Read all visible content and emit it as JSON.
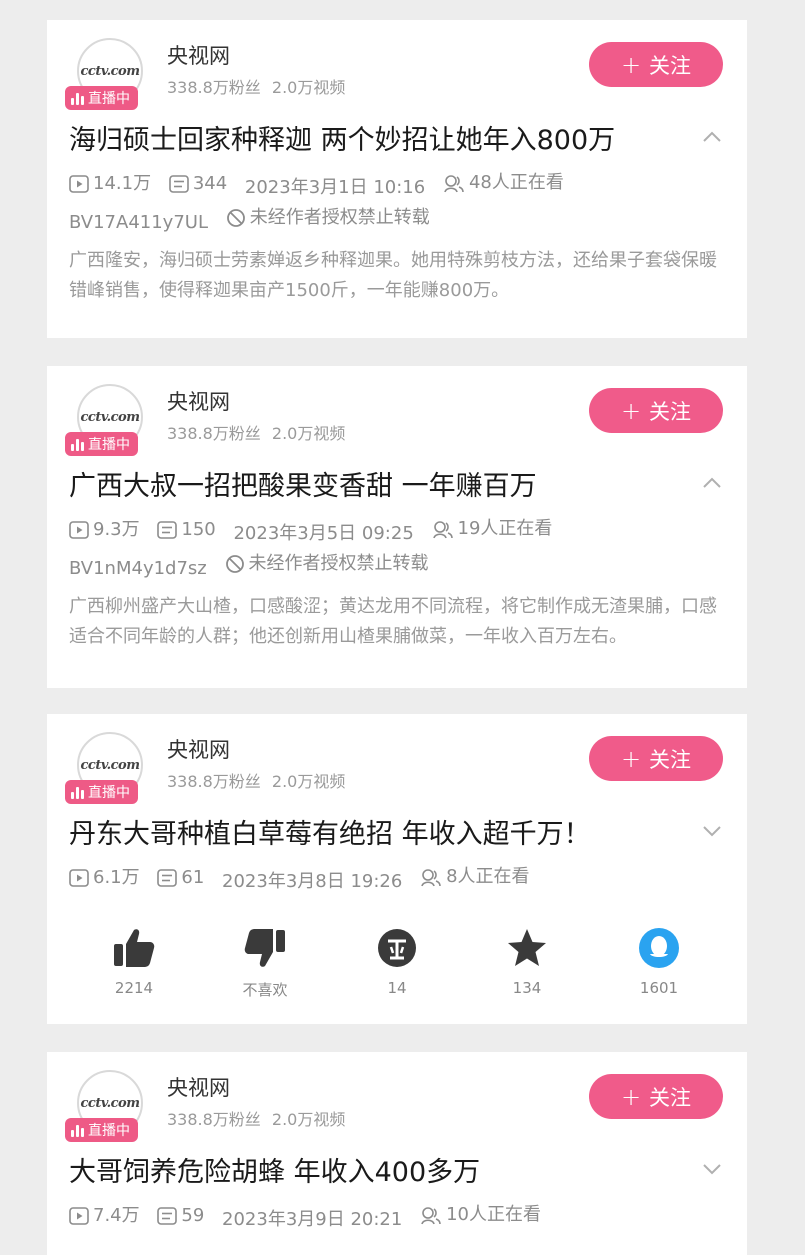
{
  "follow_label": "关注",
  "cards": [
    {
      "channel": "央视网",
      "logo_text": "cctv.com",
      "live_label": "直播中",
      "stats": "338.8万粉丝 2.0万视频",
      "title": "海归硕士回家种释迦  两个妙招让她年入800万",
      "chevron": "up",
      "plays": "14.1万",
      "comments": "344",
      "date": "2023年3月1日  10:16",
      "watching": "48人正在看",
      "bv": "BV17A411y7UL",
      "copyright": "未经作者授权禁止转载",
      "description": "广西隆安，海归硕士劳素婵返乡种释迦果。她用特殊剪枝方法，还给果子套袋保暖错峰销售，使得释迦果亩产1500斤，一年能赚800万。"
    },
    {
      "channel": "央视网",
      "logo_text": "cctv.com",
      "live_label": "直播中",
      "stats": "338.8万粉丝 2.0万视频",
      "title": "广西大叔一招把酸果变香甜  一年赚百万",
      "chevron": "up",
      "plays": "9.3万",
      "comments": "150",
      "date": "2023年3月5日  09:25",
      "watching": "19人正在看",
      "bv": "BV1nM4y1d7sz",
      "copyright": "未经作者授权禁止转载",
      "description": "广西柳州盛产大山楂，口感酸涩；黄达龙用不同流程，将它制作成无渣果脯，口感适合不同年龄的人群；他还创新用山楂果脯做菜，一年收入百万左右。"
    },
    {
      "channel": "央视网",
      "logo_text": "cctv.com",
      "live_label": "直播中",
      "stats": "338.8万粉丝 2.0万视频",
      "title": "丹东大哥种植白草莓有绝招  年收入超千万！",
      "chevron": "down",
      "plays": "6.1万",
      "comments": "61",
      "date": "2023年3月8日  19:26",
      "watching": "8人正在看",
      "actions": {
        "like": "2214",
        "dislike": "不喜欢",
        "coin": "14",
        "favorite": "134",
        "share": "1601"
      }
    },
    {
      "channel": "央视网",
      "logo_text": "cctv.com",
      "live_label": "直播中",
      "stats": "338.8万粉丝 2.0万视频",
      "title": "大哥饲养危险胡蜂  年收入400多万",
      "chevron": "down",
      "plays": "7.4万",
      "comments": "59",
      "date": "2023年3月9日  20:21",
      "watching": "10人正在看"
    }
  ]
}
